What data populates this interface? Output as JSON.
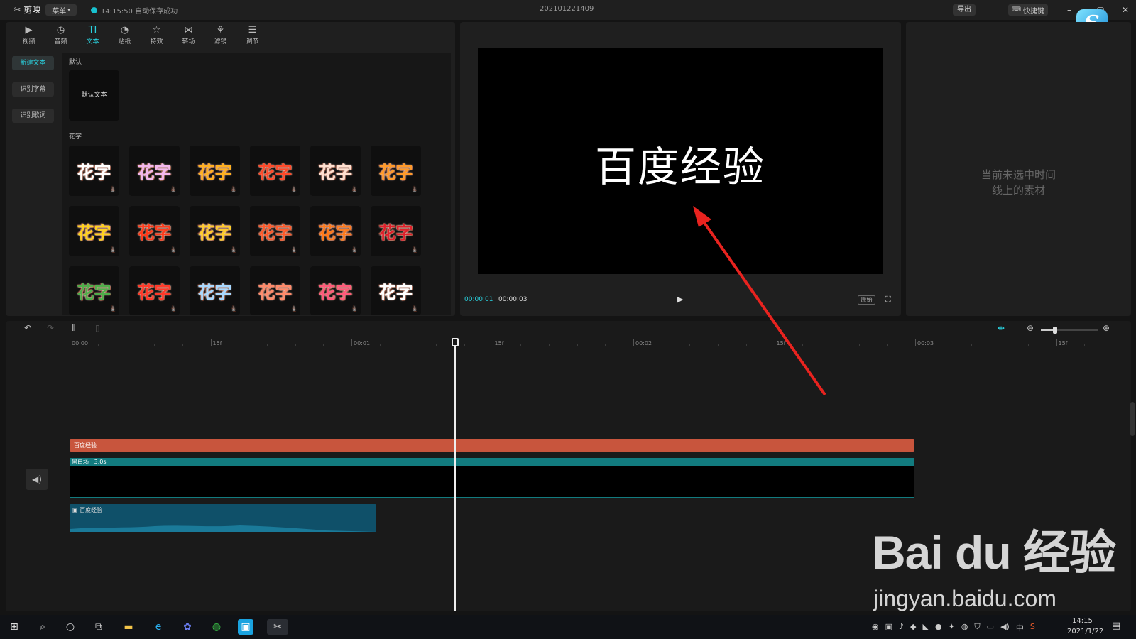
{
  "titlebar": {
    "app_name": "剪映",
    "menu_label": "菜单",
    "save_status": "14:15:50 自动保存成功",
    "project_title": "202101221409",
    "export_label": "导出",
    "shortcut_label": "快捷键",
    "logo_letter": "S"
  },
  "toolbar": {
    "items": [
      {
        "label": "视频",
        "icon": "video-icon"
      },
      {
        "label": "音频",
        "icon": "audio-icon"
      },
      {
        "label": "文本",
        "icon": "text-icon",
        "active": true
      },
      {
        "label": "贴纸",
        "icon": "sticker-icon"
      },
      {
        "label": "特效",
        "icon": "effects-icon"
      },
      {
        "label": "转场",
        "icon": "transition-icon"
      },
      {
        "label": "滤镜",
        "icon": "filter-icon"
      },
      {
        "label": "调节",
        "icon": "adjust-icon"
      }
    ]
  },
  "sidebar": {
    "items": [
      {
        "label": "新建文本",
        "active": true
      },
      {
        "label": "识别字幕"
      },
      {
        "label": "识别歌词"
      }
    ]
  },
  "library": {
    "default_section": "默认",
    "default_card": "默认文本",
    "fancy_section": "花字",
    "fancy_text": "花字",
    "fancy_colors": [
      "#ffffff",
      "#f3b7ee",
      "#ffb020",
      "#ff4a2a",
      "#ffe0d0",
      "#ff9a2a",
      "#ffd21a",
      "#ff3a1a",
      "#ffcc2a",
      "#ff5a2a",
      "#ff7a1a",
      "#e0202a",
      "#4fae4a",
      "#ff3a2a",
      "#a8d8ff",
      "#ff8a6a",
      "#ff5a7a",
      "#ffffff"
    ]
  },
  "preview": {
    "video_text": "百度经验",
    "time_current": "00:00:01",
    "time_total": "00:00:03",
    "ratio_label": "原始"
  },
  "properties": {
    "empty_line1": "当前未选中时间",
    "empty_line2": "线上的素材"
  },
  "timeline": {
    "ruler_labels": [
      "00:00",
      "15f",
      "00:01",
      "15f",
      "00:02",
      "15f",
      "00:03",
      "15f"
    ],
    "text_clip": "百度经验",
    "video_clip_name": "黑白场",
    "video_clip_duration": "3.0s",
    "audio_clip": "百度经验"
  },
  "watermark": {
    "logo": "Bai du 经验",
    "url": "jingyan.baidu.com"
  },
  "taskbar": {
    "time": "14:15",
    "date": "2021/1/22",
    "ime": "中"
  },
  "colors": {
    "accent": "#2ad2df",
    "text_clip": "#c8553d",
    "video_clip": "#127b7f",
    "audio_clip": "#0f5069",
    "annotation_arrow": "#e8231f"
  }
}
